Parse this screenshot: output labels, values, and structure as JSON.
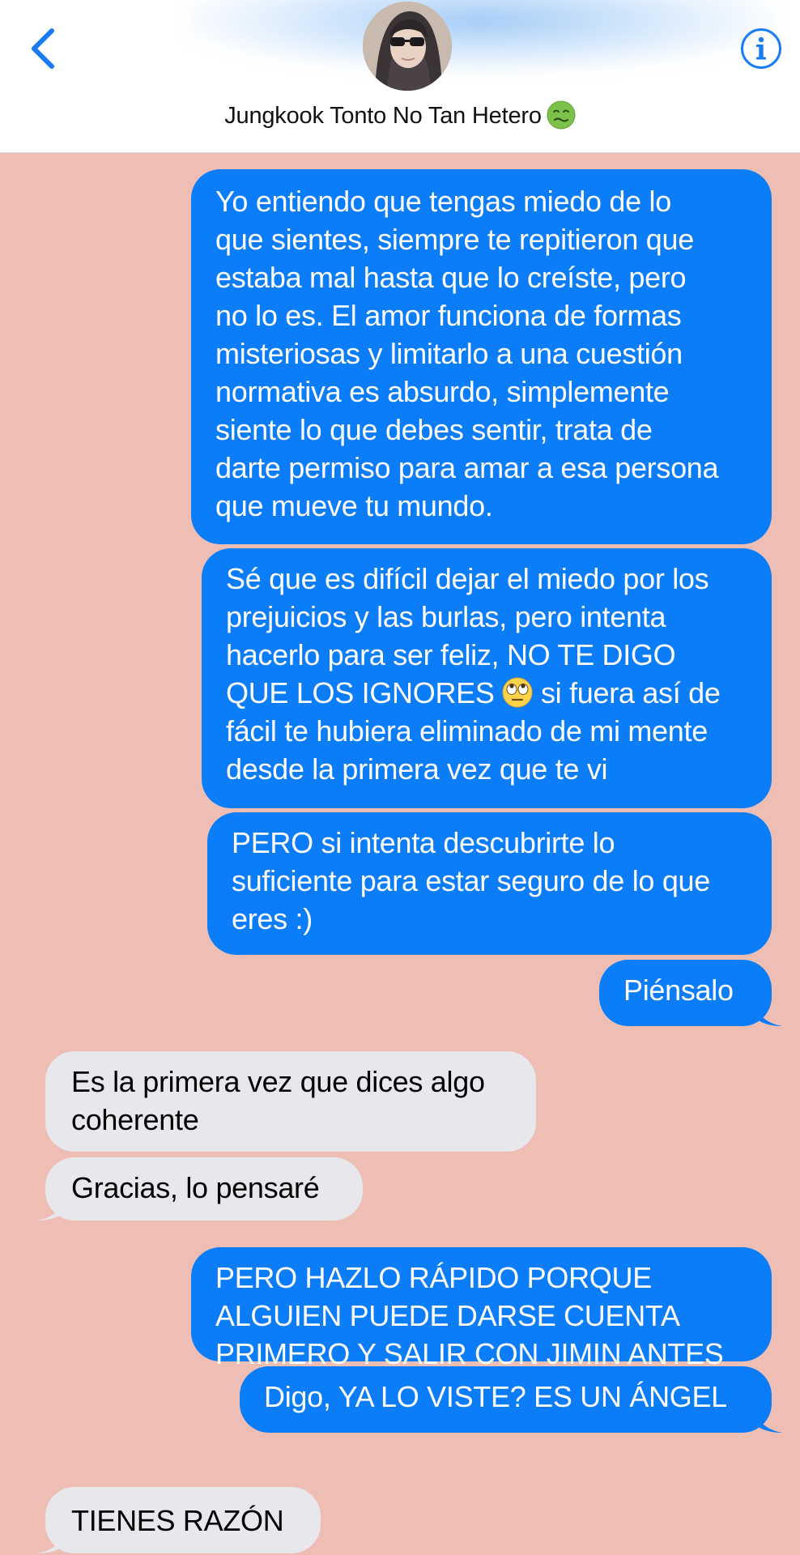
{
  "header": {
    "contact_name": "Jungkook Tonto No Tan Hetero",
    "name_emoji": "nauseated-face-emoji",
    "back_icon": "chevron-left-icon",
    "info_icon": "info-circle-icon",
    "accent_color": "#1a7cf5"
  },
  "colors": {
    "chat_background": "#eebeb4",
    "outgoing_bubble": "#0b7df8",
    "incoming_bubble": "#e8e7ec"
  },
  "messages": [
    {
      "direction": "outgoing",
      "text": "Yo entiendo que tengas miedo de lo\nque sientes, siempre te repitieron que\nestaba mal hasta que lo creíste, pero\nno lo es. El amor funciona de formas\nmisteriosas y limitarlo a una cuestión\nnormativa es absurdo, simplemente\nsiente lo que debes sentir, trata de\ndarte permiso para amar a esa persona\nque mueve tu mundo."
    },
    {
      "direction": "outgoing",
      "text_before_emoji": "Sé que es difícil dejar el miedo por los\nprejuicios y las burlas, pero intenta\nhacerlo para ser feliz, NO TE DIGO\nQUE LOS IGNORES ",
      "emoji": "face-with-rolling-eyes-emoji",
      "text_after_emoji": " si fuera así de\nfácil te hubiera eliminado de mi mente\ndesde la primera vez que te vi"
    },
    {
      "direction": "outgoing",
      "text": "PERO si intenta descubrirte lo\nsuficiente para estar seguro de lo que\neres :)"
    },
    {
      "direction": "outgoing",
      "text": "Piénsalo"
    },
    {
      "direction": "incoming",
      "text": "Es la primera vez que dices algo\ncoherente"
    },
    {
      "direction": "incoming",
      "text": "Gracias, lo pensaré"
    },
    {
      "direction": "outgoing",
      "text": "PERO HAZLO RÁPIDO PORQUE\nALGUIEN PUEDE DARSE CUENTA\nPRIMERO Y SALIR CON JIMIN ANTES"
    },
    {
      "direction": "outgoing",
      "text": "Digo, YA LO VISTE? ES UN ÁNGEL"
    },
    {
      "direction": "incoming",
      "text": "TIENES RAZÓN"
    }
  ]
}
